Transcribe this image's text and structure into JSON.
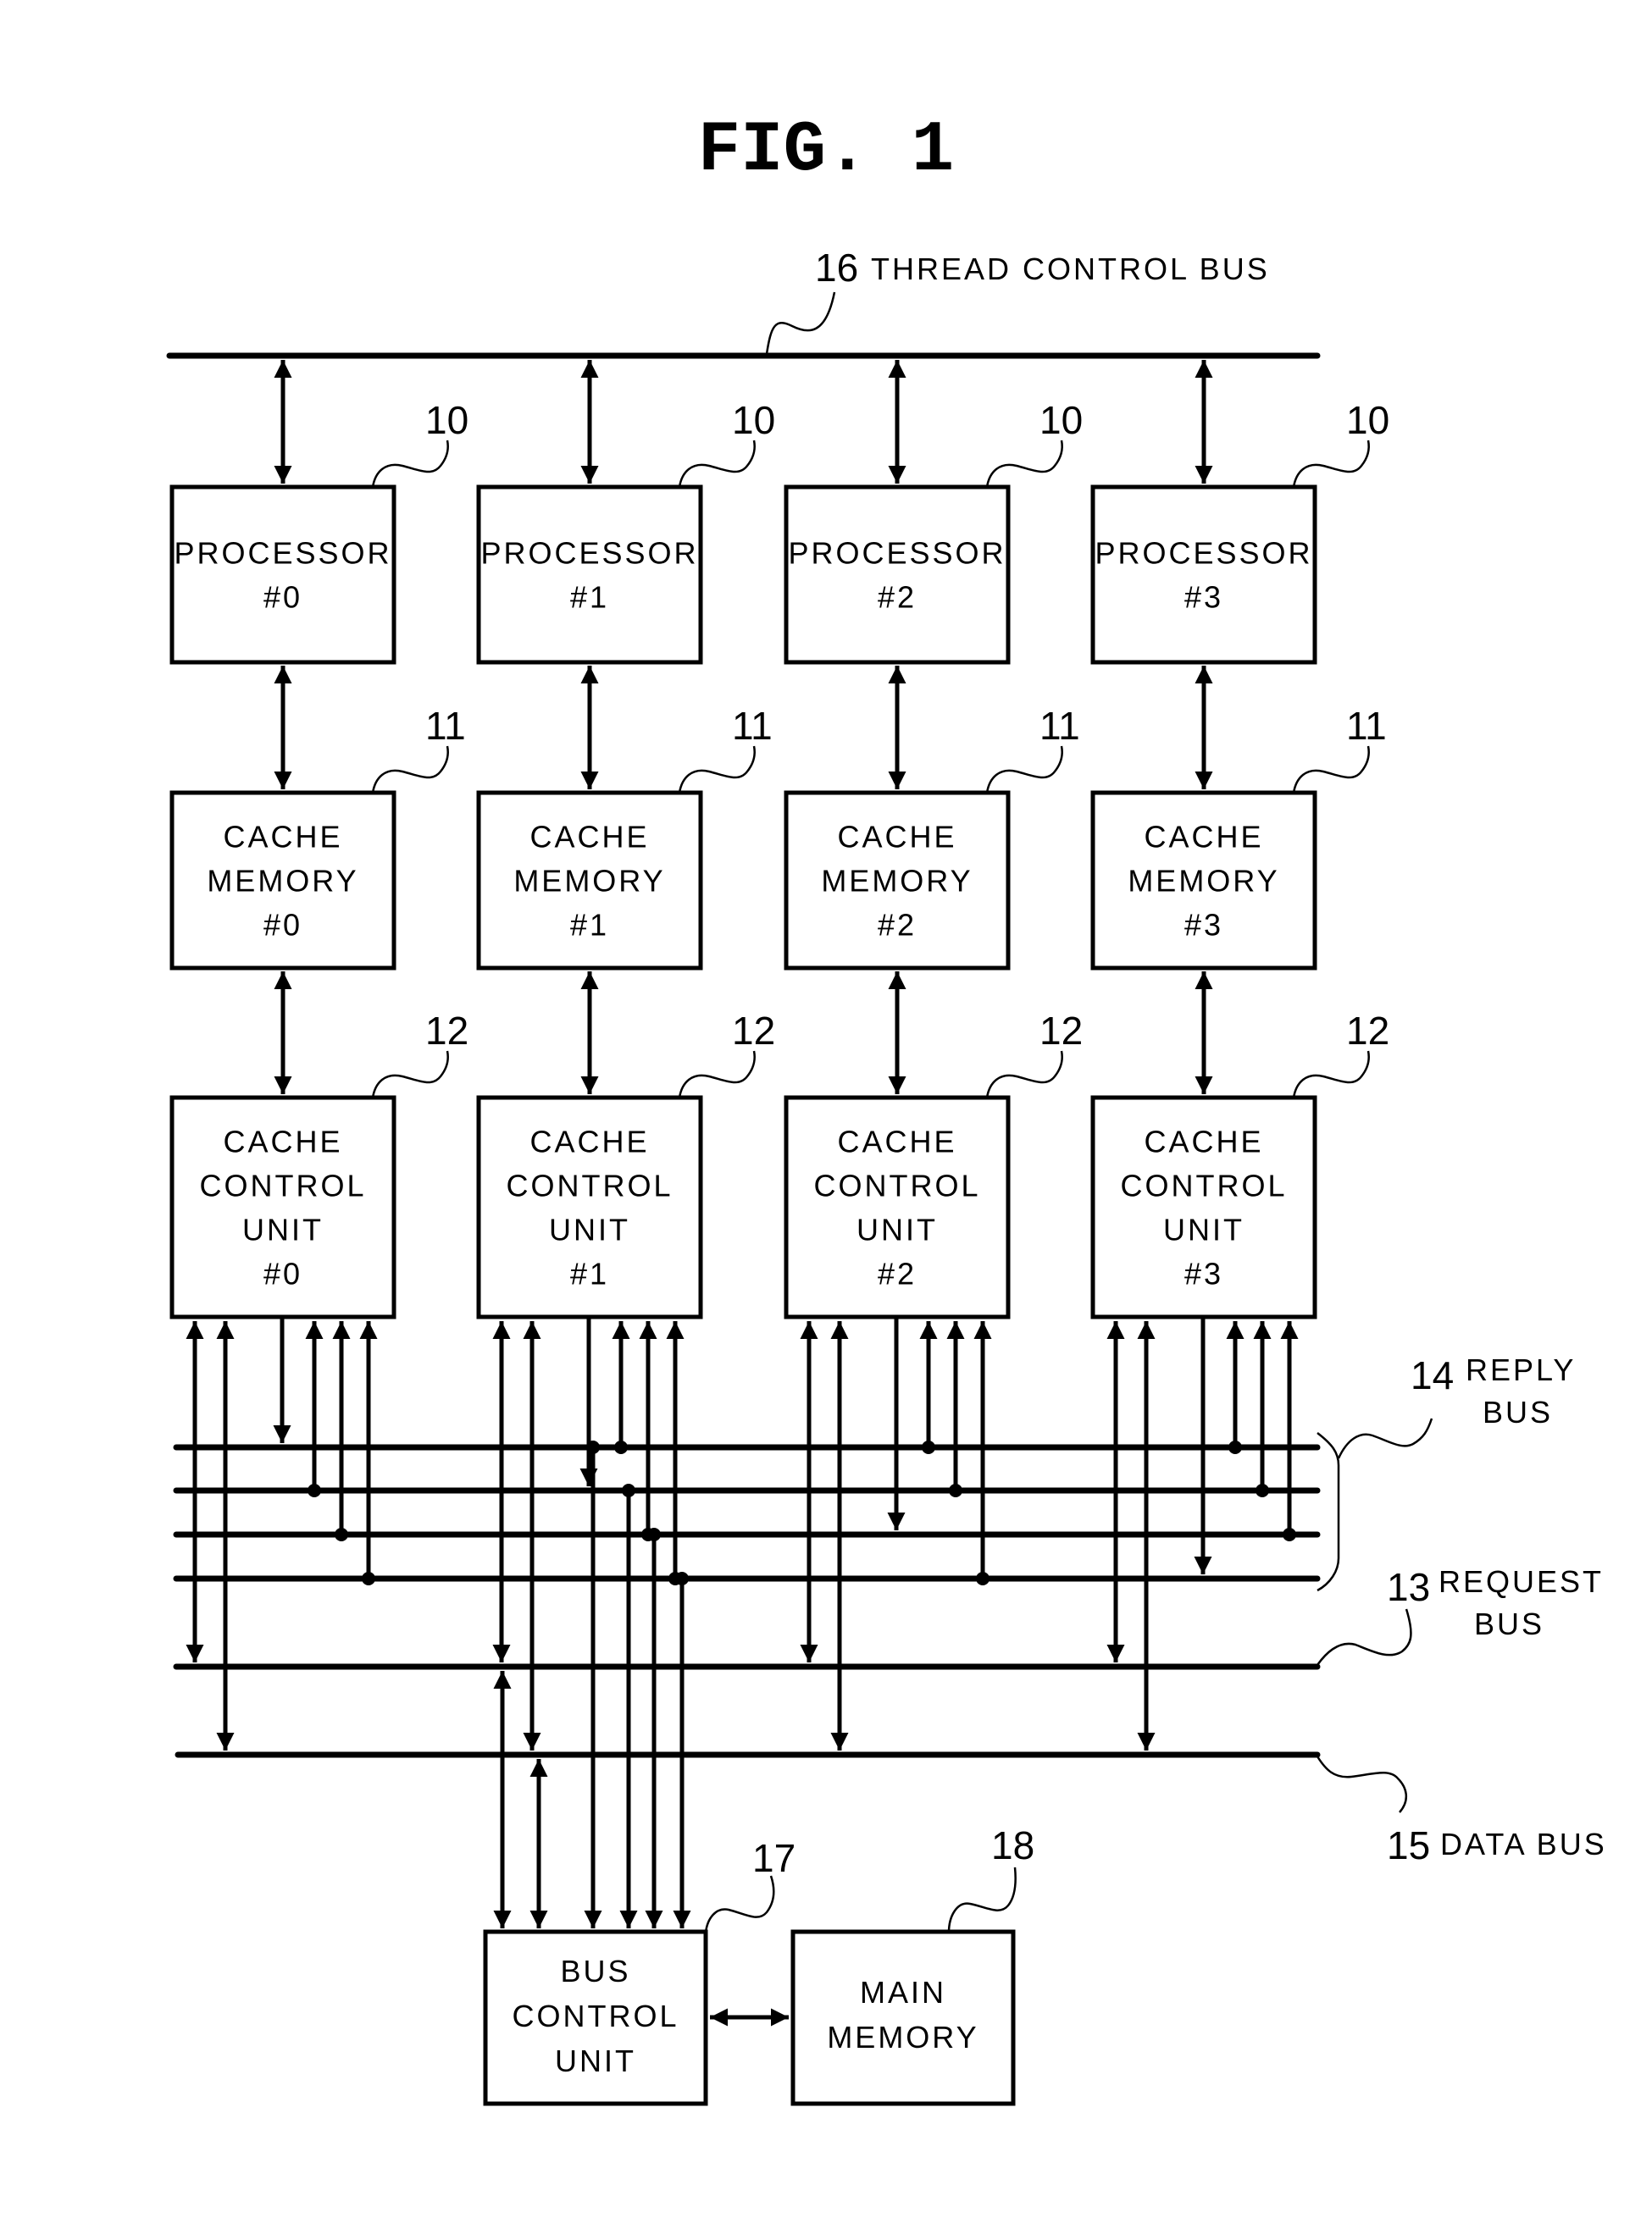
{
  "figure": {
    "title": "FIG. 1"
  },
  "buses": {
    "thread_control": {
      "ref": "16",
      "label": "THREAD CONTROL BUS"
    },
    "reply": {
      "ref": "14",
      "label_line1": "REPLY",
      "label_line2": "BUS"
    },
    "request": {
      "ref": "13",
      "label_line1": "REQUEST",
      "label_line2": "BUS"
    },
    "data": {
      "ref": "15",
      "label": "DATA BUS"
    }
  },
  "columns": [
    {
      "processor": {
        "ref": "10",
        "line1": "PROCESSOR",
        "line2": "#0"
      },
      "cache_memory": {
        "ref": "11",
        "line1": "CACHE",
        "line2": "MEMORY",
        "line3": "#0"
      },
      "cache_control": {
        "ref": "12",
        "line1": "CACHE",
        "line2": "CONTROL",
        "line3": "UNIT",
        "line4": "#0"
      }
    },
    {
      "processor": {
        "ref": "10",
        "line1": "PROCESSOR",
        "line2": "#1"
      },
      "cache_memory": {
        "ref": "11",
        "line1": "CACHE",
        "line2": "MEMORY",
        "line3": "#1"
      },
      "cache_control": {
        "ref": "12",
        "line1": "CACHE",
        "line2": "CONTROL",
        "line3": "UNIT",
        "line4": "#1"
      }
    },
    {
      "processor": {
        "ref": "10",
        "line1": "PROCESSOR",
        "line2": "#2"
      },
      "cache_memory": {
        "ref": "11",
        "line1": "CACHE",
        "line2": "MEMORY",
        "line3": "#2"
      },
      "cache_control": {
        "ref": "12",
        "line1": "CACHE",
        "line2": "CONTROL",
        "line3": "UNIT",
        "line4": "#2"
      }
    },
    {
      "processor": {
        "ref": "10",
        "line1": "PROCESSOR",
        "line2": "#3"
      },
      "cache_memory": {
        "ref": "11",
        "line1": "CACHE",
        "line2": "MEMORY",
        "line3": "#3"
      },
      "cache_control": {
        "ref": "12",
        "line1": "CACHE",
        "line2": "CONTROL",
        "line3": "UNIT",
        "line4": "#3"
      }
    }
  ],
  "bus_control_unit": {
    "ref": "17",
    "line1": "BUS",
    "line2": "CONTROL",
    "line3": "UNIT"
  },
  "main_memory": {
    "ref": "18",
    "line1": "MAIN",
    "line2": "MEMORY"
  }
}
